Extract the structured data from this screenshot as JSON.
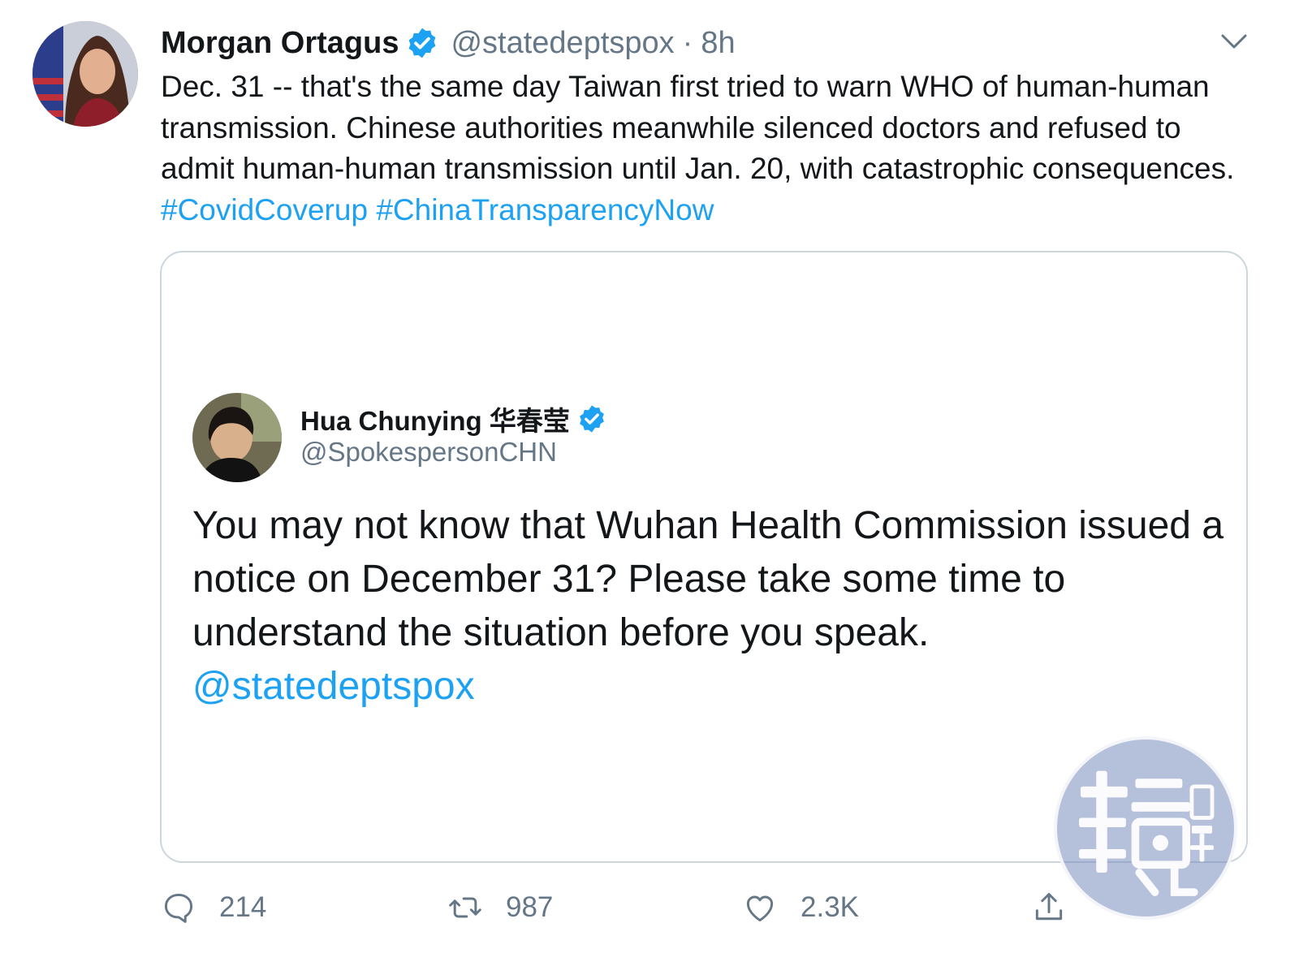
{
  "tweet": {
    "author_name": "Morgan Ortagus",
    "author_handle": "@statedeptspox",
    "separator": "·",
    "time": "8h",
    "text_main": "Dec. 31 -- that's the same day Taiwan first tried to warn WHO of human-human transmission. Chinese authorities meanwhile silenced doctors and refused to admit human-human transmission until Jan. 20, with catastrophic consequences. ",
    "hashtag_1": "#CovidCoverup",
    "hashtag_2": "#ChinaTransparencyNow"
  },
  "quote": {
    "author_name": "Hua Chunying 华春莹",
    "author_handle": "@SpokespersonCHN",
    "text": "You may not know that Wuhan Health Commission issued a notice on December 31? Please take some time to understand the situation before you speak.",
    "mention": "@statedeptspox"
  },
  "actions": {
    "reply_count": "214",
    "retweet_count": "987",
    "like_count": "2.3K"
  },
  "watermark": {
    "text": "鏡週刊"
  },
  "colors": {
    "link": "#1da1f2",
    "secondary_text": "#657786",
    "border": "#ccd6dd",
    "verified": "#1da1f2"
  },
  "icons": [
    "verified-badge-icon",
    "caret-down-icon",
    "reply-icon",
    "retweet-icon",
    "like-icon",
    "share-icon"
  ]
}
